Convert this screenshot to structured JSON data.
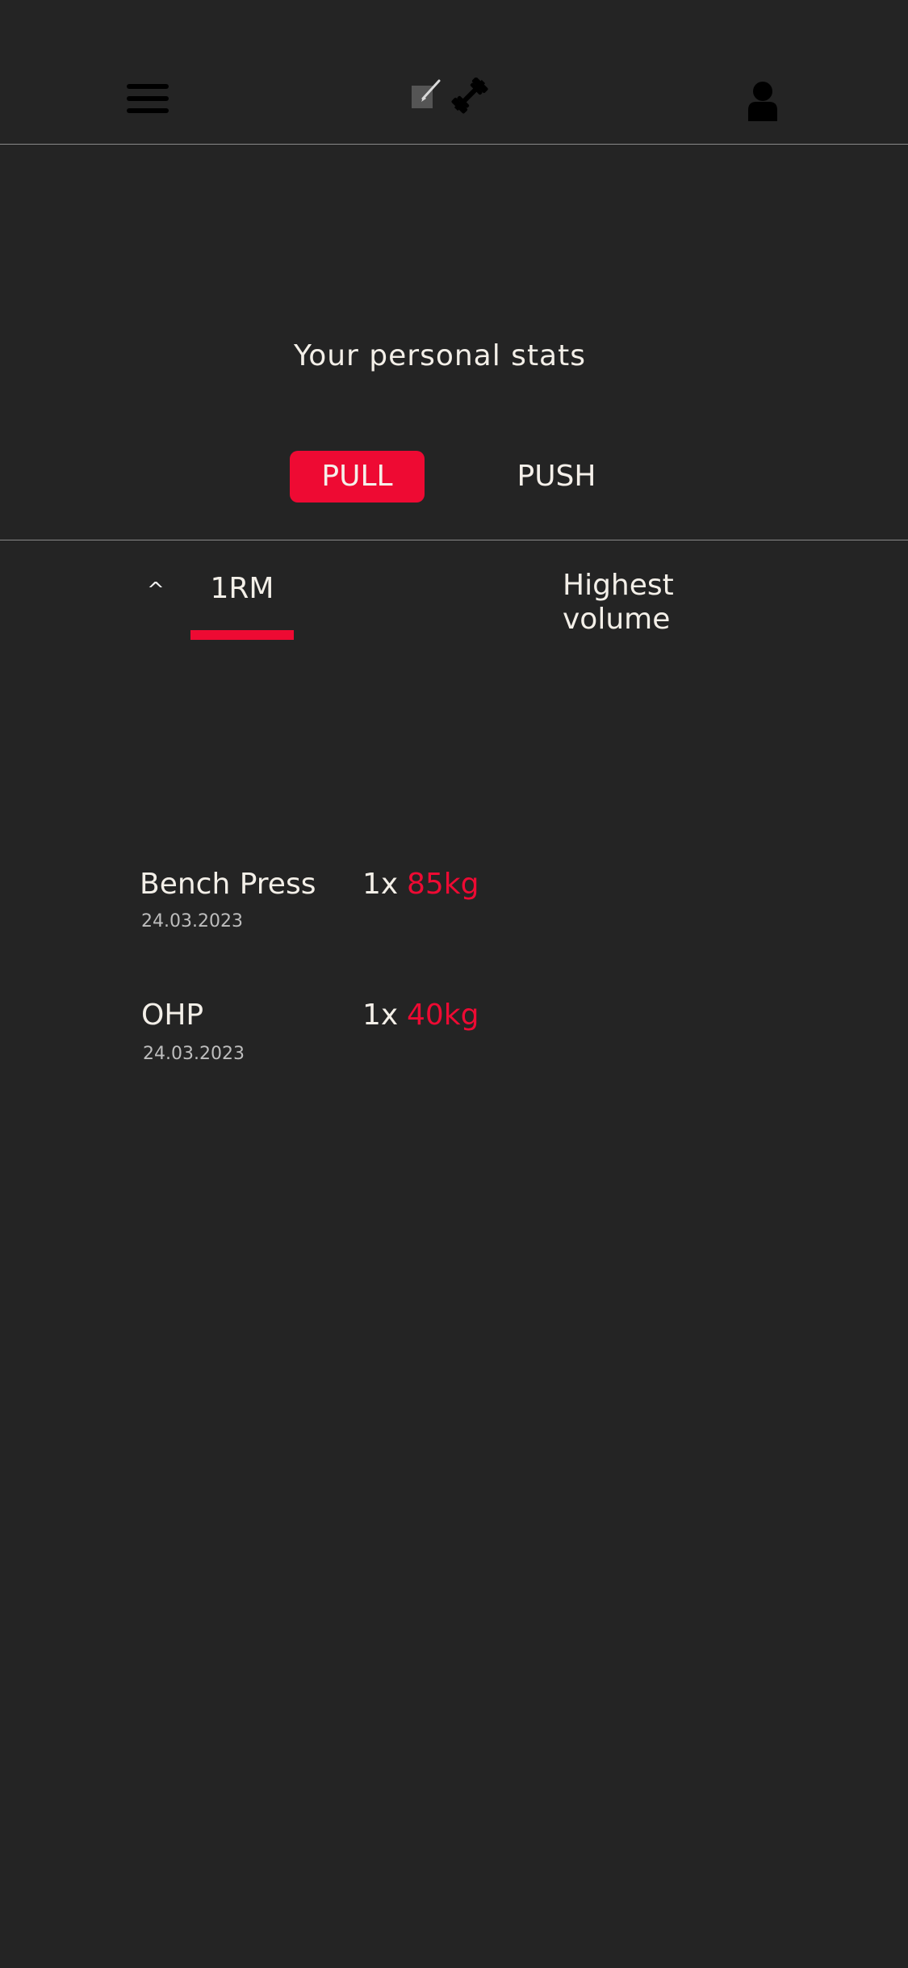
{
  "header": {
    "menu_icon": "hamburger-menu-icon",
    "logo_icons": [
      "notepad-pencil-icon",
      "dumbbell-icon"
    ],
    "profile_icon": "user-profile-icon"
  },
  "page": {
    "title": "Your personal stats"
  },
  "segments": {
    "pull_label": "PULL",
    "push_label": "PUSH",
    "active": "PULL"
  },
  "tabs": {
    "sort_caret": "^",
    "one_rm_label": "1RM",
    "volume_label_line1": "Highest",
    "volume_label_line2": "volume",
    "active": "1RM"
  },
  "stats": [
    {
      "name": "Bench Press",
      "date": "24.03.2023",
      "reps": "1x",
      "weight": "85kg"
    },
    {
      "name": "OHP",
      "date": "24.03.2023",
      "reps": "1x",
      "weight": "40kg"
    }
  ],
  "colors": {
    "background": "#242424",
    "accent": "#ee0a33",
    "text": "#f3efe8",
    "muted": "#bdbdbd",
    "divider": "#8a8a8a"
  }
}
